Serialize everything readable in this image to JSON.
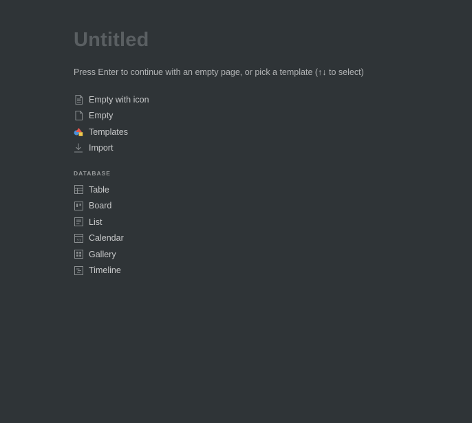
{
  "page": {
    "title": "Untitled",
    "hint": "Press Enter to continue with an empty page, or pick a template (↑↓ to select)"
  },
  "options": [
    {
      "label": "Empty with icon",
      "icon": "document-lines-icon"
    },
    {
      "label": "Empty",
      "icon": "document-blank-icon"
    },
    {
      "label": "Templates",
      "icon": "templates-shapes-icon"
    },
    {
      "label": "Import",
      "icon": "download-arrow-icon"
    }
  ],
  "database": {
    "header": "DATABASE",
    "items": [
      {
        "label": "Table",
        "icon": "table-icon"
      },
      {
        "label": "Board",
        "icon": "board-icon"
      },
      {
        "label": "List",
        "icon": "list-icon"
      },
      {
        "label": "Calendar",
        "icon": "calendar-icon"
      },
      {
        "label": "Gallery",
        "icon": "gallery-icon"
      },
      {
        "label": "Timeline",
        "icon": "timeline-icon"
      }
    ]
  },
  "colors": {
    "background": "#2f3437",
    "title": "#5a5f62",
    "icon_stroke": "#8a8e90",
    "templates_blue": "#4a90d9",
    "templates_red": "#e8574e",
    "templates_yellow": "#f2c94c"
  }
}
